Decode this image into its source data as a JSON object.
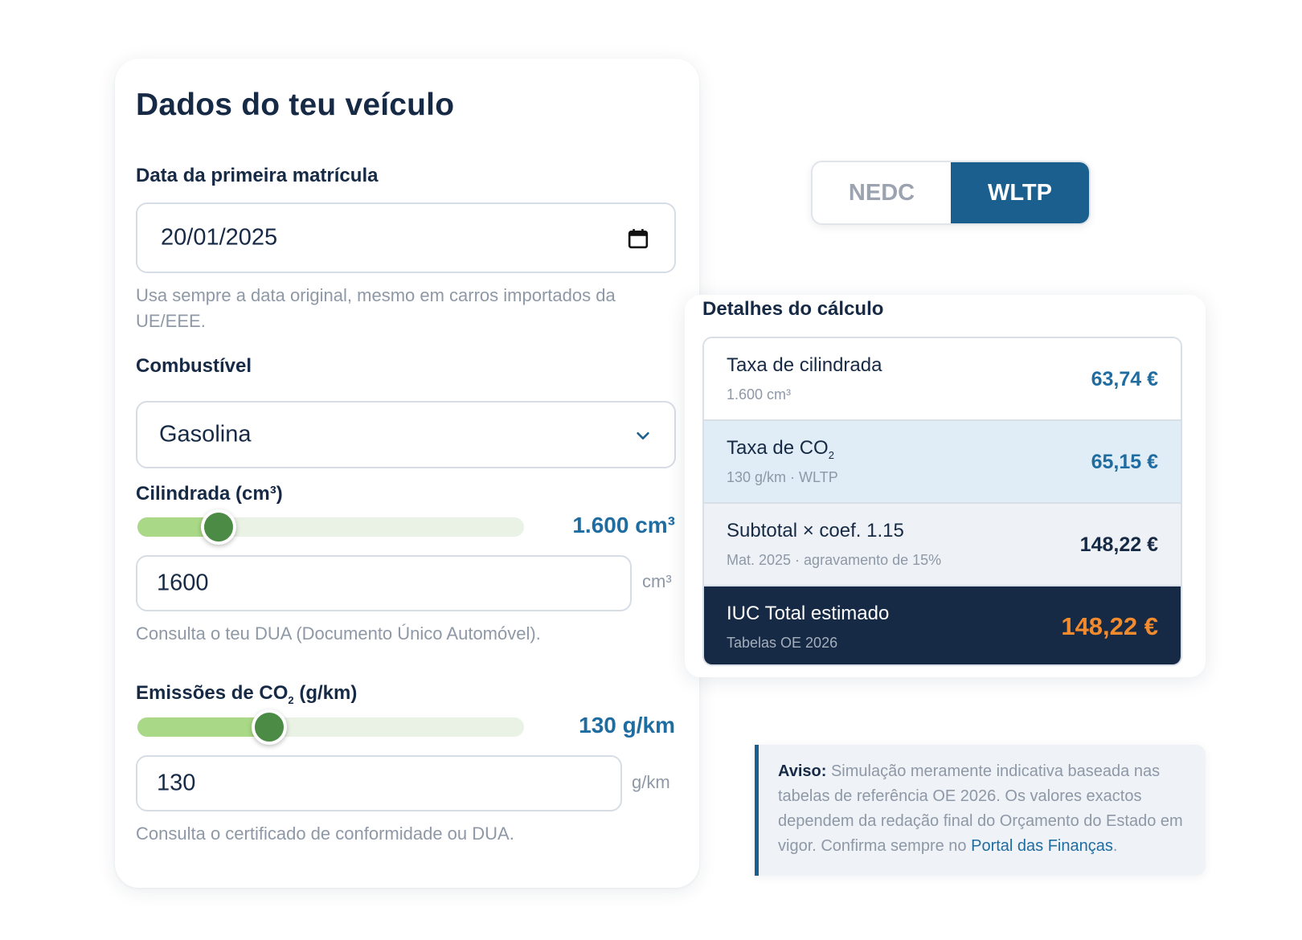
{
  "form": {
    "title": "Dados do teu veículo",
    "date": {
      "label": "Data da primeira matrícula",
      "value": "20/01/2025",
      "hint": "Usa sempre a data original, mesmo em carros importados da UE/EEE."
    },
    "fuel": {
      "label": "Combustível",
      "value": "Gasolina"
    },
    "displacement": {
      "label": "Cilindrada (cm³)",
      "slider_display": "1.600 cm³",
      "slider_fraction": 0.21,
      "input_value": "1600",
      "unit": "cm³",
      "hint": "Consulta o teu DUA (Documento Único Automóvel)."
    },
    "emissions": {
      "label_prefix": "Emissões de CO",
      "label_sub": "2",
      "label_suffix": " (g/km)",
      "slider_display": "130 g/km",
      "slider_fraction": 0.34,
      "input_value": "130",
      "unit": "g/km",
      "hint": "Consulta o certificado de conformidade ou DUA."
    }
  },
  "toggle": {
    "options": [
      "NEDC",
      "WLTP"
    ],
    "selected": "WLTP"
  },
  "calc": {
    "title": "Detalhes do cálculo",
    "rows": [
      {
        "label": "Taxa de cilindrada",
        "sub": "1.600 cm³",
        "value": "63,74 €"
      },
      {
        "label_prefix": "Taxa de CO",
        "label_sub": "2",
        "sub": "130 g/km · WLTP",
        "value": "65,15 €"
      },
      {
        "label": "Subtotal × coef. 1.15",
        "sub": "Mat. 2025 · agravamento de 15%",
        "value": "148,22 €"
      },
      {
        "label": "IUC Total estimado",
        "sub": "Tabelas OE 2026",
        "value": "148,22 €"
      }
    ]
  },
  "warning": {
    "strong": "Aviso:",
    "text": " Simulação meramente indicativa baseada nas tabelas de referência OE 2026. Os valores exactos dependem da redação final do Orçamento do Estado em vigor. Confirma sempre no ",
    "link": "Portal das Finanças",
    "end": "."
  },
  "colors": {
    "navy": "#172a45",
    "accent_blue": "#1a5f8d",
    "value_blue": "#1f6ca1",
    "slider_green": "#a9d886",
    "thumb_green": "#4c8b46",
    "total_orange": "#f28a2e"
  }
}
